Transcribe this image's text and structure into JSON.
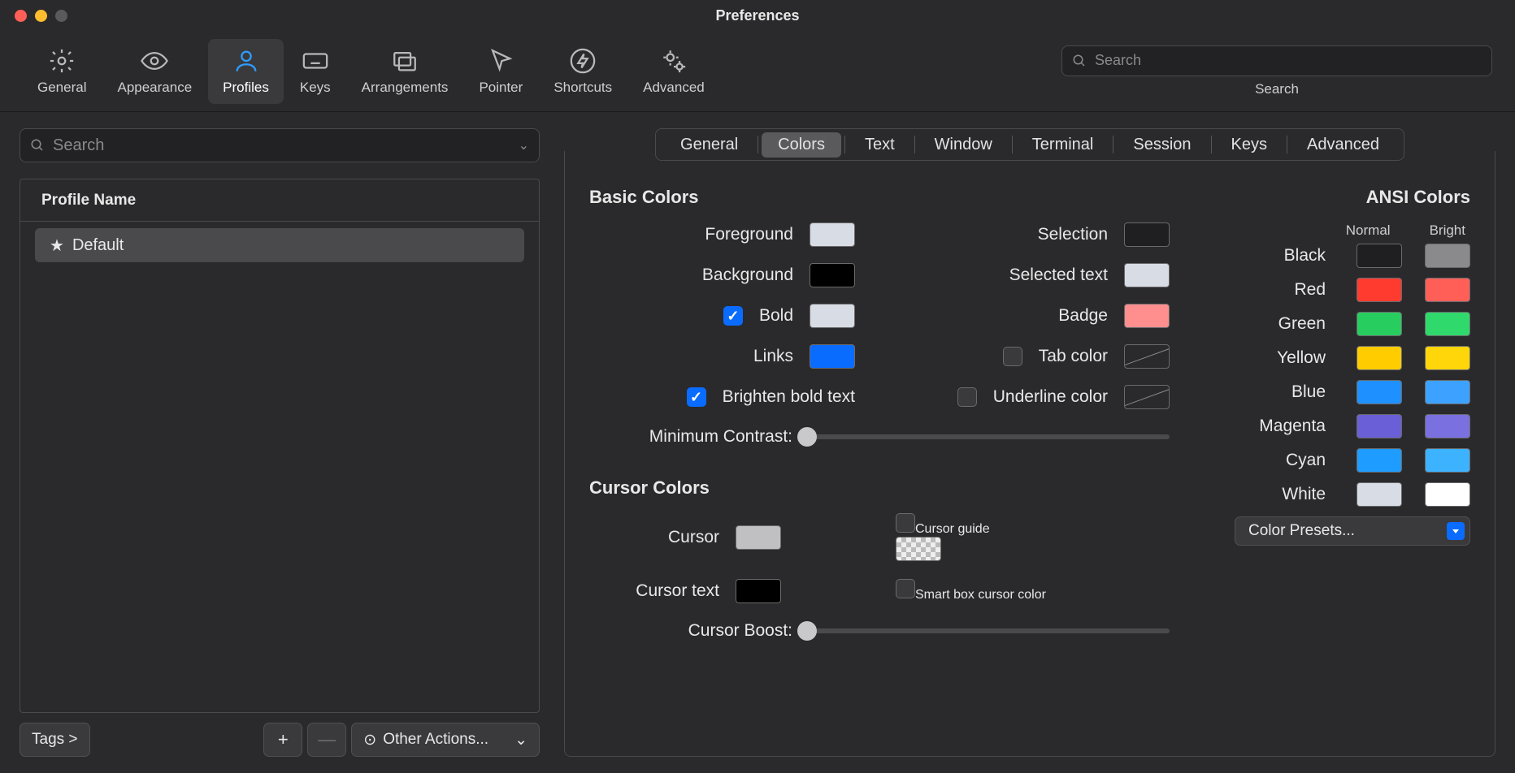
{
  "window": {
    "title": "Preferences"
  },
  "toolbar": {
    "items": [
      {
        "label": "General",
        "icon": "gear"
      },
      {
        "label": "Appearance",
        "icon": "eye"
      },
      {
        "label": "Profiles",
        "icon": "person",
        "active": true
      },
      {
        "label": "Keys",
        "icon": "keyboard"
      },
      {
        "label": "Arrangements",
        "icon": "windows"
      },
      {
        "label": "Pointer",
        "icon": "pointer"
      },
      {
        "label": "Shortcuts",
        "icon": "bolt"
      },
      {
        "label": "Advanced",
        "icon": "gears"
      }
    ],
    "search": {
      "placeholder": "Search",
      "label": "Search"
    }
  },
  "sidebar": {
    "search_placeholder": "Search",
    "header": "Profile Name",
    "profiles": [
      {
        "name": "Default",
        "starred": true,
        "selected": true
      }
    ],
    "footer": {
      "tags_label": "Tags >",
      "add": "+",
      "remove": "—",
      "other_actions": "Other Actions..."
    }
  },
  "tabs": [
    "General",
    "Colors",
    "Text",
    "Window",
    "Terminal",
    "Session",
    "Keys",
    "Advanced"
  ],
  "active_tab": "Colors",
  "basic_colors": {
    "title": "Basic Colors",
    "left": [
      {
        "label": "Foreground",
        "color": "#d8dce4"
      },
      {
        "label": "Background",
        "color": "#000000"
      },
      {
        "label": "Bold",
        "checkbox": true,
        "checked": true,
        "color": "#d8dce4"
      },
      {
        "label": "Links",
        "color": "#0a6cff"
      }
    ],
    "right": [
      {
        "label": "Selection",
        "color": "#1f1f21"
      },
      {
        "label": "Selected text",
        "color": "#d8dce4"
      },
      {
        "label": "Badge",
        "color": "#ff8e8e"
      },
      {
        "label": "Tab color",
        "checkbox": true,
        "checked": false,
        "none": true
      },
      {
        "label": "Underline color",
        "checkbox": true,
        "checked": false,
        "none": true
      }
    ],
    "brighten": {
      "label": "Brighten bold text",
      "checked": true
    },
    "min_contrast": {
      "label": "Minimum Contrast:",
      "value": 0
    }
  },
  "cursor_colors": {
    "title": "Cursor Colors",
    "cursor": {
      "label": "Cursor",
      "color": "#c0c0c2"
    },
    "cursor_text": {
      "label": "Cursor text",
      "color": "#000000"
    },
    "cursor_guide": {
      "label": "Cursor guide",
      "checked": false,
      "checker": true
    },
    "smart_box": {
      "label": "Smart box cursor color",
      "checked": false
    },
    "boost": {
      "label": "Cursor Boost:",
      "value": 0
    }
  },
  "ansi": {
    "title": "ANSI Colors",
    "head_normal": "Normal",
    "head_bright": "Bright",
    "rows": [
      {
        "label": "Black",
        "normal": "#1f1f21",
        "bright": "#8a8a8c"
      },
      {
        "label": "Red",
        "normal": "#ff3b30",
        "bright": "#ff5f57"
      },
      {
        "label": "Green",
        "normal": "#28cd5f",
        "bright": "#30d96b"
      },
      {
        "label": "Yellow",
        "normal": "#ffcc00",
        "bright": "#ffd60a"
      },
      {
        "label": "Blue",
        "normal": "#1e90ff",
        "bright": "#3da2ff"
      },
      {
        "label": "Magenta",
        "normal": "#6a5fd6",
        "bright": "#7a70e0"
      },
      {
        "label": "Cyan",
        "normal": "#1e9cff",
        "bright": "#3db2ff"
      },
      {
        "label": "White",
        "normal": "#d8dce4",
        "bright": "#ffffff"
      }
    ]
  },
  "presets": {
    "label": "Color Presets..."
  }
}
